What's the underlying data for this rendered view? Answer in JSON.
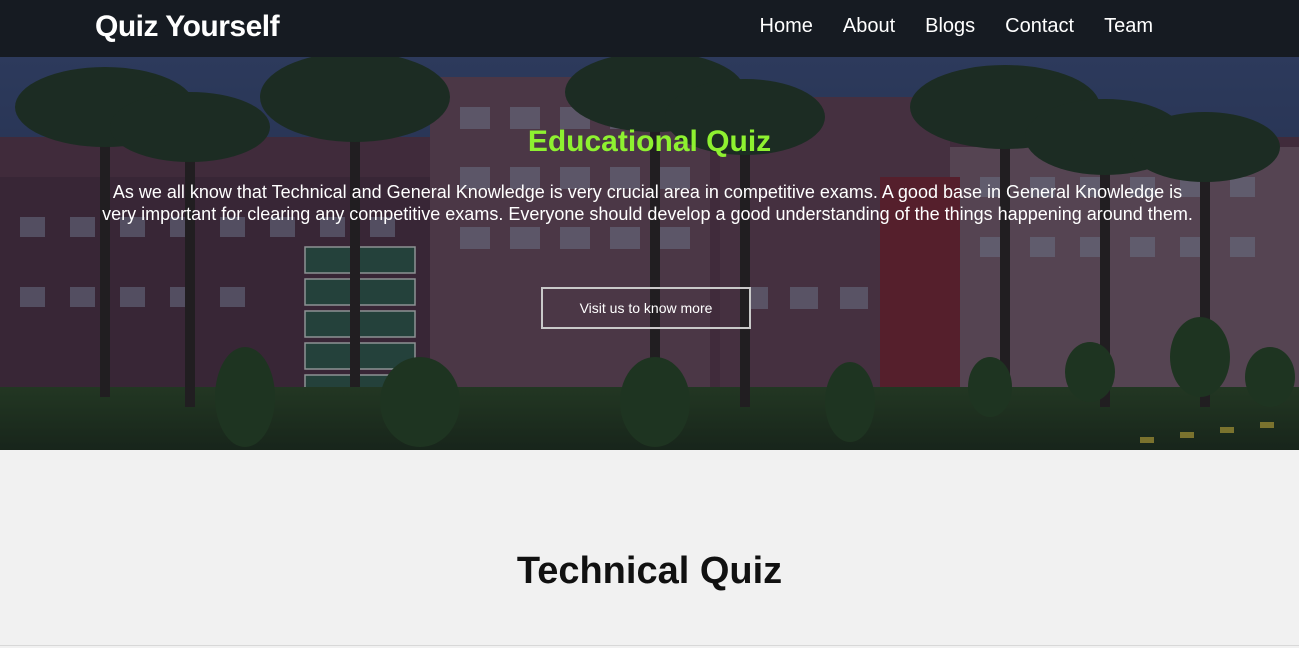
{
  "brand": "Quiz Yourself",
  "nav": {
    "items": [
      {
        "label": "Home"
      },
      {
        "label": "About"
      },
      {
        "label": "Blogs"
      },
      {
        "label": "Contact"
      },
      {
        "label": "Team"
      }
    ]
  },
  "hero": {
    "title": "Educational Quiz",
    "text": "As we all know that Technical and General Knowledge is very crucial area in competitive exams. A good base in General Knowledge is very important for clearing any competitive exams. Everyone should develop a good understanding of the things happening around them.",
    "button_label": "Visit us to know more"
  },
  "section": {
    "title": "Technical Quiz"
  },
  "colors": {
    "navbar": "#161b22",
    "accent": "#8ef130",
    "page_bg": "#f1f1f1"
  }
}
